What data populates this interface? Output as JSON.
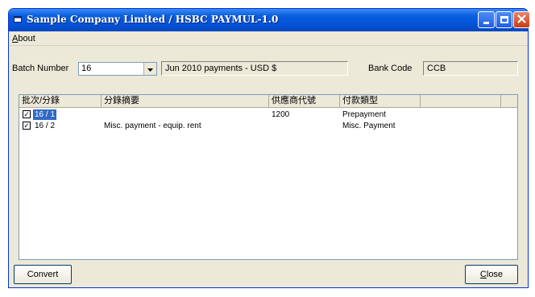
{
  "window": {
    "title": "Sample Company Limited / HSBC PAYMUL-1.0",
    "icon": "app-window-icon",
    "controls": [
      "minimize-icon",
      "maximize-icon",
      "close-icon"
    ]
  },
  "menu": {
    "about": {
      "accel": "A",
      "rest": "bout"
    }
  },
  "batch": {
    "label": "Batch Number",
    "value": "16",
    "description": "Jun 2010 payments - USD $"
  },
  "bank": {
    "label": "Bank Code",
    "value": "CCB"
  },
  "list": {
    "columns": [
      "批次/分錄",
      "分錄摘要",
      "供應商代號",
      "付款類型",
      ""
    ],
    "rows": [
      {
        "checked": true,
        "batch": "16 / 1",
        "summary": "",
        "supplier": "1200",
        "type": "Prepayment",
        "selected": true
      },
      {
        "checked": true,
        "batch": "16 / 2",
        "summary": "Misc. payment - equip. rent",
        "supplier": "",
        "type": "Misc. Payment",
        "selected": false
      }
    ]
  },
  "buttons": {
    "convert": "Convert",
    "close": {
      "accel": "C",
      "rest": "lose"
    }
  },
  "colors": {
    "titlebar": "#0a5fe0",
    "selection": "#316ac5",
    "face": "#ece9d8"
  }
}
